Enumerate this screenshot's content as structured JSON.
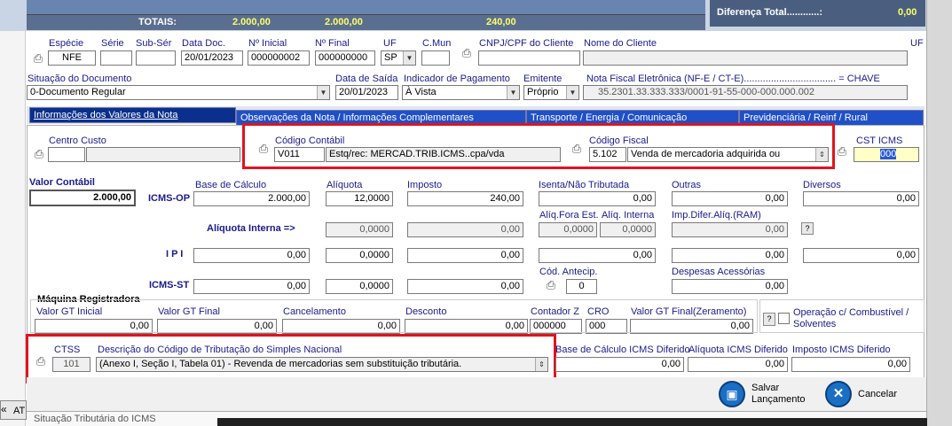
{
  "totals": {
    "label": "TOTAIS:",
    "v1": "2.000,00",
    "v2": "2.000,00",
    "v3": "240,00",
    "diff_label": "Diferença Total............:",
    "diff_value": "0,00"
  },
  "doc": {
    "especie_label": "Espécie",
    "especie": "NFE",
    "serie_label": "Série",
    "serie": "",
    "subser_label": "Sub-Sér",
    "subser": "",
    "datadoc_label": "Data Doc.",
    "datadoc": "20/01/2023",
    "nini_label": "Nº Inicial",
    "nini": "000000002",
    "nfim_label": "Nº Final",
    "nfim": "000000000",
    "uf_label": "UF",
    "uf": "SP",
    "cmun_label": "C.Mun",
    "cmun": "",
    "cnpj_label": "CNPJ/CPF do Cliente",
    "cnpj": "",
    "nome_label": "Nome do Cliente",
    "nome": "",
    "uf2_label": "UF"
  },
  "sit": {
    "situacao_label": "Situação do Documento",
    "situacao": "0-Documento Regular",
    "datasaida_label": "Data de Saída",
    "datasaida": "20/01/2023",
    "indpag_label": "Indicador de Pagamento",
    "indpag": "À Vista",
    "emitente_label": "Emitente",
    "emitente": "Próprio",
    "nfe_label": "Nota Fiscal Eletrônica (NF-E / CT-E)..................................  =  CHAVE",
    "chave": "35.2301.33.333.333/0001-91-55-000-000.000.002"
  },
  "tabs": [
    "Informações dos Valores da Nota",
    "Observações da Nota / Informações Complementares",
    "Transporte / Energia / Comunicação",
    "Previdenciária / Reinf / Rural"
  ],
  "contab": {
    "centro_label": "Centro Custo",
    "centro": "",
    "codcont_label": "Código Contábil",
    "codcont": "V011",
    "codcont_desc": "Estq/rec: MERCAD.TRIB.ICMS..cpa/vda",
    "codfisc_label": "Código Fiscal",
    "codfisc": "5.102",
    "codfisc_desc": "Venda de mercadoria adquirida ou",
    "cst_label": "CST ICMS",
    "cst": "000"
  },
  "valores": {
    "vc_label": "Valor Contábil",
    "vc": "2.000,00",
    "icmsop_label": "ICMS-OP",
    "base_label": "Base de Cálculo",
    "aliq_label": "Alíquota",
    "imposto_label": "Imposto",
    "isenta_label": "Isenta/Não Tributada",
    "outras_label": "Outras",
    "diversos_label": "Diversos",
    "base": "2.000,00",
    "aliq": "12,0000",
    "imposto": "240,00",
    "isenta": "0,00",
    "outras": "0,00",
    "diversos": "0,00",
    "aliqfora_label": "Alíq.Fora Est.",
    "aliqint_label": "Alíq. Interna",
    "impdif_label": "Imp.Difer.Alíq.(RAM)",
    "aliqint2_label": "Alíquota Interna =>",
    "ai1": "0,0000",
    "ai2": "0,00",
    "afe": "0,0000",
    "aint": "0,0000",
    "impdif": "0,00",
    "ipi_label": "I P I",
    "ipi_base": "0,00",
    "ipi_aliq": "0,0000",
    "ipi_imp": "0,00",
    "ipi_isenta": "0,00",
    "ipi_outras": "0,00",
    "ipi_div": "0,00",
    "icmsst_label": "ICMS-ST",
    "st_base": "0,00",
    "st_aliq": "0,0000",
    "st_imp": "0,00",
    "codant_label": "Cód. Antecip.",
    "codant": "0",
    "despesas_label": "Despesas Acessórias",
    "despesas": "0,00"
  },
  "maquina": {
    "title": "Máquina Registradora",
    "gtini_label": "Valor GT Inicial",
    "gtini": "0,00",
    "gtfim_label": "Valor GT Final",
    "gtfim": "0,00",
    "canc_label": "Cancelamento",
    "canc": "0,00",
    "desc_label": "Desconto",
    "desc": "0,00",
    "contz_label": "Contador Z",
    "contz": "000000",
    "cro_label": "CRO",
    "cro": "000",
    "gtzer_label": "Valor GT Final(Zeramento)",
    "gtzer": "0,00",
    "comb_label": "Operação c/ Combustível / Solventes"
  },
  "ctss": {
    "ctss_label": "CTSS",
    "ctss": "101",
    "desc_label": "Descrição do Código de Tributação do Simples Nacional",
    "desc": "(Anexo I, Seção I, Tabela 01) - Revenda de mercadorias sem substituição tributária.",
    "basedif_label": "Base de Cálculo ICMS Diferido",
    "basedif": "0,00",
    "aliqdif_label": "Alíquota ICMS Diferido",
    "aliqdif": "0,00",
    "impdif_label": "Imposto ICMS Diferido",
    "impdif": "0,00"
  },
  "actions": {
    "salvar": "Salvar\nLançamento",
    "cancelar": "Cancelar"
  },
  "footer": {
    "sit_trib": "Situação Tributária do ICMS",
    "at": "AT"
  },
  "colors": {
    "accent_red": "#e0141e",
    "tab_blue": "#0a2f8c",
    "header_blue": "#6a84b0"
  }
}
